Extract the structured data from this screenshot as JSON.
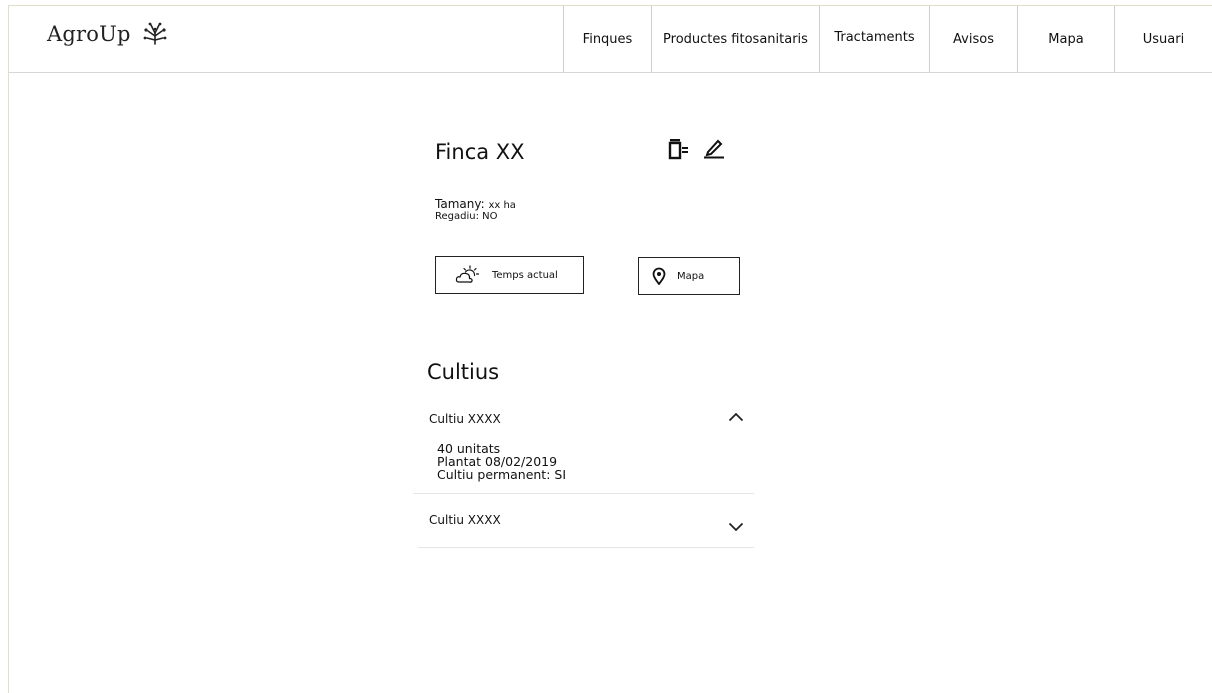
{
  "brand": {
    "name": "AgroUp"
  },
  "nav": {
    "items": [
      {
        "label": "Finques"
      },
      {
        "label": "Productes fitosanitaris"
      },
      {
        "label": "Tractaments"
      },
      {
        "label": "Avisos"
      },
      {
        "label": "Mapa"
      },
      {
        "label": "Usuari"
      }
    ]
  },
  "finca": {
    "title": "Finca XX",
    "size_label": "Tamany:",
    "size_value": "xx ha",
    "irrigation": "Regadiu: NO"
  },
  "buttons": {
    "weather": "Temps actual",
    "map": "Mapa"
  },
  "crops": {
    "title": "Cultius",
    "items": [
      {
        "name": "Cultiu XXXX",
        "expanded": true,
        "details": [
          "40 unitats",
          "Plantat 08/02/2019",
          "Cultiu permanent: SI"
        ]
      },
      {
        "name": "Cultiu XXXX",
        "expanded": false
      }
    ]
  },
  "icons": {
    "logo": "sprout-icon",
    "delete": "trash-icon",
    "edit": "pencil-icon",
    "weather": "sun-cloud-icon",
    "map": "map-pin-icon",
    "collapse": "chevron-up-icon",
    "expand": "chevron-down-icon"
  }
}
